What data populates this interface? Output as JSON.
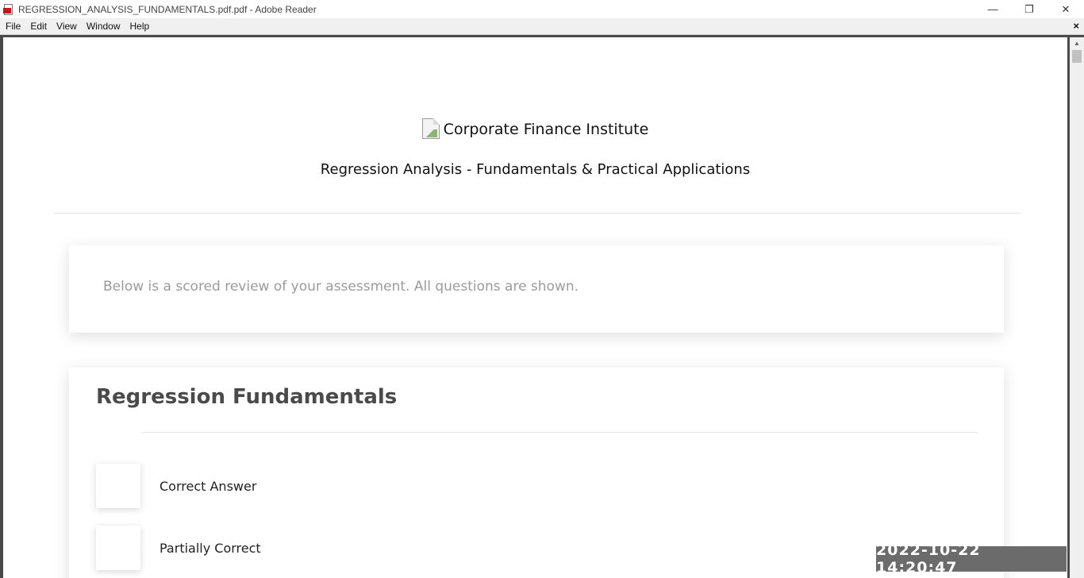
{
  "window": {
    "title": "REGRESSION_ANALYSIS_FUNDAMENTALS.pdf.pdf - Adobe Reader",
    "minimize": "—",
    "restore": "❐",
    "close": "✕",
    "doc_close": "×"
  },
  "menu": {
    "items": [
      "File",
      "Edit",
      "View",
      "Window",
      "Help"
    ]
  },
  "document": {
    "logo_alt": "Corporate Finance Institute",
    "course_title": "Regression Analysis - Fundamentals & Practical Applications",
    "intro_text": "Below is a scored review of your assessment. All questions are shown.",
    "section_title": "Regression Fundamentals",
    "legend": [
      {
        "label": "Correct Answer"
      },
      {
        "label": "Partially Correct"
      }
    ]
  },
  "scrollbar": {
    "up_arrow": "▲"
  },
  "overlay": {
    "timestamp": "2022-10-22 14:20:47"
  }
}
